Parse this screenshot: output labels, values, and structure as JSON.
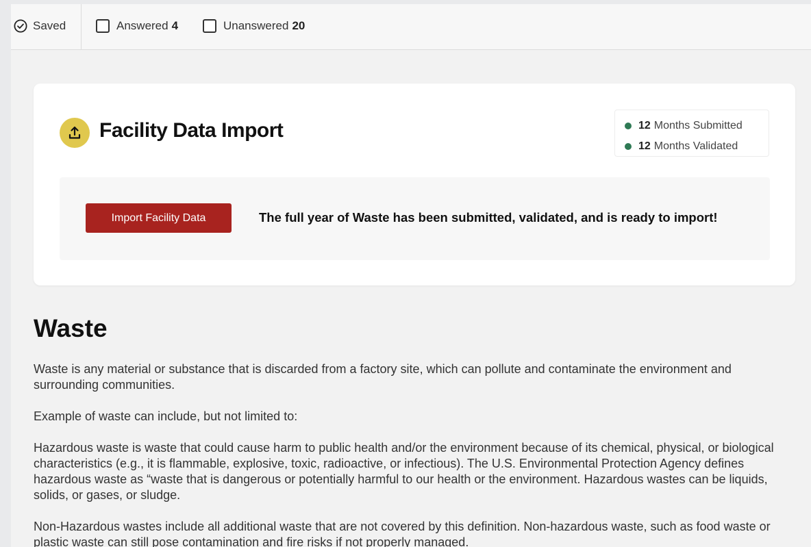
{
  "topbar": {
    "saved_label": "Saved",
    "answered_label": "Answered",
    "answered_count": "4",
    "unanswered_label": "Unanswered",
    "unanswered_count": "20"
  },
  "import_card": {
    "title": "Facility Data Import",
    "status": [
      {
        "count": "12",
        "label": "Months Submitted"
      },
      {
        "count": "12",
        "label": "Months Validated"
      }
    ],
    "button_label": "Import Facility Data",
    "message": "The full year of Waste has been submitted, validated, and is ready to import!"
  },
  "section": {
    "title": "Waste",
    "paragraphs": [
      "Waste is any material or substance that is discarded from a factory site, which can pollute and contaminate the environment and surrounding communities.",
      "Example of waste can include, but not limited to:",
      "Hazardous waste is waste that could cause harm to public health and/or the environment because of its chemical, physical, or biological characteristics (e.g., it is flammable, explosive, toxic, radioactive, or infectious). The U.S. Environmental Protection Agency defines hazardous waste as “waste that is dangerous or potentially harmful to our health or the environment. Hazardous wastes can be liquids, solids, or gases, or sludge.",
      "Non-Hazardous wastes include all additional waste that are not covered by this definition. Non-hazardous waste, such as food waste or plastic waste can still pose contamination and fire risks if not properly managed."
    ]
  },
  "colors": {
    "button": "#a8231f",
    "status_dot": "#2f7a55",
    "icon_bg": "#e0c84e"
  },
  "icons": {
    "saved": "check-circle-icon",
    "import": "upload-icon"
  }
}
